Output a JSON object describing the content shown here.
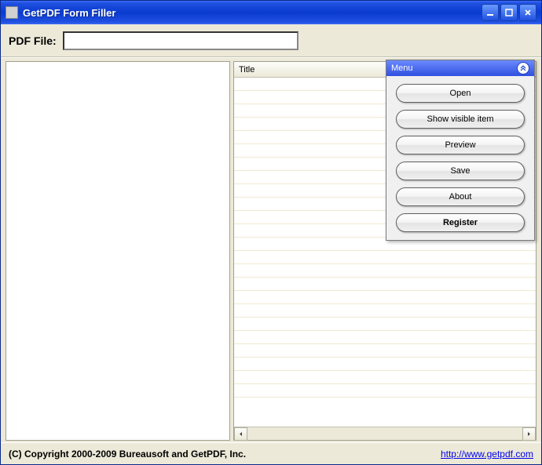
{
  "window": {
    "title": "GetPDF Form Filler"
  },
  "toolbar": {
    "pdf_label": "PDF File:",
    "pdf_value": ""
  },
  "grid": {
    "col_title": "Title"
  },
  "menu": {
    "header": "Menu",
    "buttons": {
      "open": "Open",
      "show_visible": "Show visible item",
      "preview": "Preview",
      "save": "Save",
      "about": "About",
      "register": "Register"
    }
  },
  "status": {
    "copyright": "(C) Copyright 2000-2009 Bureausoft and GetPDF, Inc.",
    "link_text": "http://www.getpdf.com"
  }
}
